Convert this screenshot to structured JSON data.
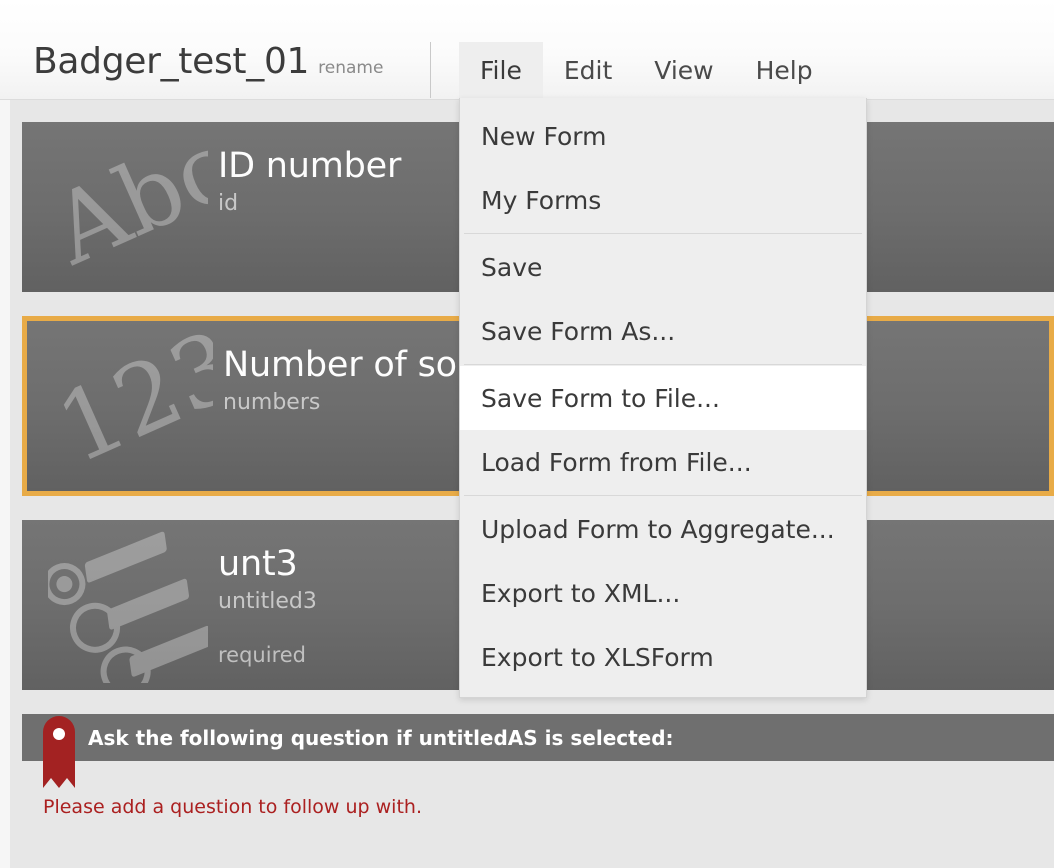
{
  "header": {
    "form_title": "Badger_test_01",
    "rename_label": "rename"
  },
  "menubar": {
    "items": [
      {
        "label": "File",
        "active": true
      },
      {
        "label": "Edit",
        "active": false
      },
      {
        "label": "View",
        "active": false
      },
      {
        "label": "Help",
        "active": false
      }
    ]
  },
  "file_menu": {
    "items": [
      {
        "label": "New Form"
      },
      {
        "label": "My Forms"
      },
      {
        "label": "Save"
      },
      {
        "label": "Save Form As..."
      },
      {
        "label": "Save Form to File...",
        "highlighted": true
      },
      {
        "label": "Load Form from File..."
      },
      {
        "label": "Upload Form to Aggregate..."
      },
      {
        "label": "Export to XML..."
      },
      {
        "label": "Export to XLSForm"
      }
    ]
  },
  "cards": [
    {
      "title": "ID number",
      "name": "id",
      "icon": "abc-text-icon",
      "required_label": "",
      "selected": false
    },
    {
      "title": "Number of som",
      "name": "numbers",
      "icon": "123-number-icon",
      "required_label": "",
      "selected": true
    },
    {
      "title": "unt3",
      "name": "untitled3",
      "icon": "select-one-radio-icon",
      "required_label": "required",
      "selected": false
    }
  ],
  "skip_logic": {
    "text": "Ask the following question if untitledAS is selected:",
    "bookmark_icon": "bookmark-ribbon-icon"
  },
  "error": {
    "message": "Please add a question to follow up with."
  },
  "colors": {
    "page_background": "#e7e7e7",
    "card_top": "#757575",
    "card_bottom": "#616161",
    "selected_border": "#e8ab47",
    "menu_background": "#eeeeee",
    "menu_highlight": "#ffffff",
    "error_red": "#ab2020",
    "bookmark_red": "#a32222",
    "skip_bar": "#6f6f6f"
  }
}
